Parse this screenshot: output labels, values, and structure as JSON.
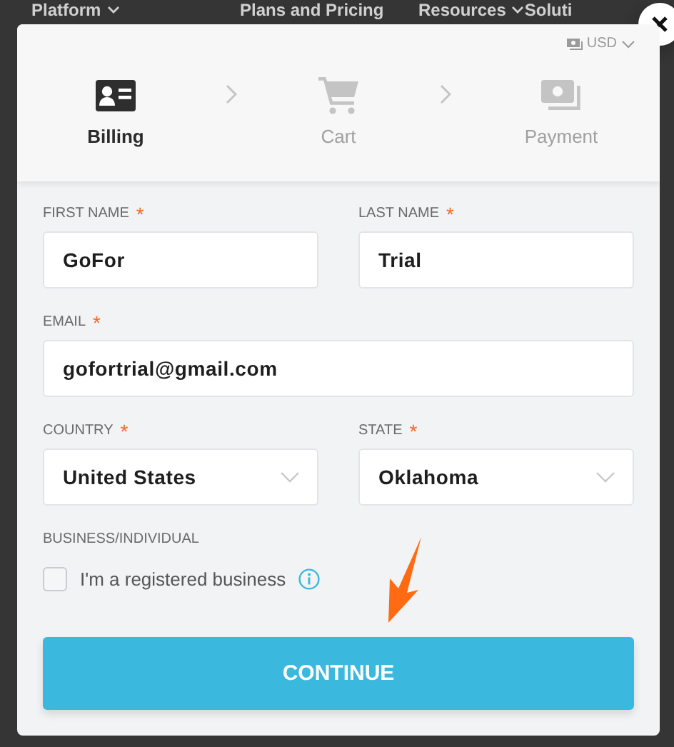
{
  "background_nav": {
    "items": [
      {
        "label": "Platform",
        "dropdown": true
      },
      {
        "label": "Plans and Pricing",
        "dropdown": false
      },
      {
        "label": "Resources",
        "dropdown": true
      },
      {
        "label": "Soluti",
        "dropdown": false
      }
    ]
  },
  "dialog": {
    "currency": "USD",
    "steps": [
      {
        "label": "Billing",
        "selected": true
      },
      {
        "label": "Cart",
        "selected": false
      },
      {
        "label": "Payment",
        "selected": false
      }
    ],
    "rows": [
      [
        {
          "label": "FIRST NAME",
          "required_mark": "*",
          "kind": "text",
          "value": "GoFor"
        },
        {
          "label": "LAST NAME",
          "required_mark": "*",
          "kind": "text",
          "value": "Trial"
        }
      ],
      [
        {
          "label": "EMAIL",
          "required_mark": "*",
          "kind": "text",
          "value": "gofortrial@gmail.com"
        }
      ],
      [
        {
          "label": "COUNTRY",
          "required_mark": "*",
          "kind": "select",
          "value": "United States"
        },
        {
          "label": "STATE",
          "required_mark": "*",
          "kind": "select",
          "value": "Oklahoma"
        }
      ]
    ],
    "business": {
      "label": "BUSINESS/INDIVIDUAL",
      "option": "I'm a registered business",
      "checked": false
    },
    "continue_button": "CONTINUE"
  }
}
